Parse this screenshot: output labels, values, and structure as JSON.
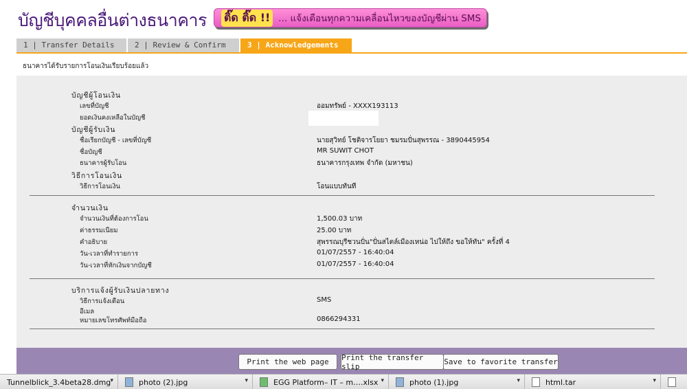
{
  "header": {
    "title": "บัญชีบุคคลอื่นต่างธนาคาร",
    "banner_tag": "ติ๊ด ติ๊ด !!",
    "banner_text": "... แจ้งเตือนทุกความเคลื่อนไหวของบัญชีผ่าน SMS"
  },
  "tabs": [
    {
      "label": "1 | Transfer Details"
    },
    {
      "label": "2 | Review & Confirm"
    },
    {
      "label": "3 | Acknowledgements"
    }
  ],
  "notice": "ธนาคารได้รับรายการโอนเงินเรียบร้อยแล้ว",
  "from_section": {
    "heading": "บัญชีผู้โอนเงิน",
    "account_label": "เลขที่บัญชี",
    "account_value": "ออมทรัพย์ - XXXX193113",
    "balance_label": "ยอดเงินคงเหลือในบัญชี"
  },
  "to_section": {
    "heading": "บัญชีผู้รับเงิน",
    "name_acct_label": "ชื่อเรียกบัญชี - เลขที่บัญชี",
    "name_acct_value": "นายสุวิทย์ โชติจารโยยา ชมรมปั่นสุพรรณ - 3890445954",
    "acct_name_label": "ชื่อบัญชี",
    "acct_name_value": "MR SUWIT CHOT",
    "bank_label": "ธนาคารผู้รับโอน",
    "bank_value": "ธนาคารกรุงเทพ จำกัด (มหาชน)"
  },
  "method_section": {
    "heading": "วิธีการโอนเงิน",
    "method_label": "วิธีการโอนเงิน",
    "method_value": "โอนแบบทันที"
  },
  "amount_section": {
    "heading": "จำนวนเงิน",
    "amount_label": "จำนวนเงินที่ต้องการโอน",
    "amount_value": "1,500.03 บาท",
    "fee_label": "ค่าธรรมเนียม",
    "fee_value": "25.00  บาท",
    "desc_label": "คำอธิบาย",
    "desc_value": "สุพรรณบุรีชวนปั่น\"ปั่นสไตล์เมืองเหน่อ ไปให้ถึง ขอให้ทัน\" ครั้งที่ 4",
    "txn_time_label": "วัน-เวลาที่ทำรายการ",
    "txn_time_value": "01/07/2557 - 16:40:04",
    "debit_time_label": "วัน-เวลาที่หักเงินจากบัญชี",
    "debit_time_value": "01/07/2557 - 16:40:04"
  },
  "notify_section": {
    "heading": "บริการแจ้งผู้รับเงินปลายทาง",
    "method_label": "วิธีการแจ้งเตือน",
    "method_value": "SMS",
    "email_label": "อีเมล",
    "phone_label": "หมายเลขโทรศัพท์มือถือ",
    "phone_value": "0866294331"
  },
  "actions": {
    "print_page": "Print the web page",
    "print_slip": "Print the transfer slip",
    "save_favorite": "Save to favorite transfer"
  },
  "downloads": [
    {
      "name": "Tunnelblick_3.4beta28.dmg",
      "icon": "dmg-file-icon"
    },
    {
      "name": "photo (2).jpg",
      "icon": "image-file-icon"
    },
    {
      "name": "EGG Platform– IT – m….xlsx",
      "icon": "excel-file-icon"
    },
    {
      "name": "photo (1).jpg",
      "icon": "image-file-icon"
    },
    {
      "name": "html.tar",
      "icon": "archive-file-icon"
    }
  ],
  "colors": {
    "title": "#4a1a7a",
    "active_tab": "#f7a618",
    "panel": "#ededed",
    "action_bar": "#9a86b3"
  }
}
